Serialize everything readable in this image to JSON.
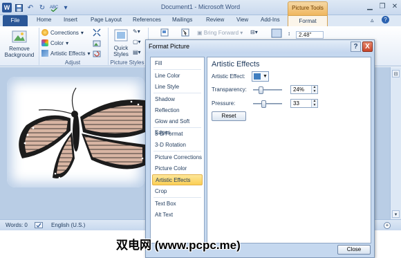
{
  "window": {
    "title": "Document1 - Microsoft Word",
    "contextual_tab_header": "Picture Tools"
  },
  "qat": {
    "app_icon": "W",
    "icons": [
      "save-icon",
      "undo-icon",
      "redo-icon",
      "spelling-icon",
      "customize-icon"
    ]
  },
  "tabs": {
    "file": "File",
    "home": "Home",
    "insert": "Insert",
    "page_layout": "Page Layout",
    "references": "References",
    "mailings": "Mailings",
    "review": "Review",
    "view": "View",
    "addins": "Add-Ins",
    "format": "Format"
  },
  "ribbon": {
    "remove_background_line1": "Remove",
    "remove_background_line2": "Background",
    "corrections": "Corrections",
    "color": "Color",
    "artistic_effects": "Artistic Effects",
    "adjust_group": "Adjust",
    "quick_styles_line1": "Quick",
    "quick_styles_line2": "Styles",
    "picture_styles_group": "Picture Styles",
    "bring_forward": "Bring Forward",
    "height_value": "2.48\""
  },
  "status": {
    "words": "Words: 0",
    "language": "English (U.S.)"
  },
  "dialog": {
    "title": "Format Picture",
    "help": "?",
    "close_x": "X",
    "nav": [
      {
        "label": "Fill"
      },
      {
        "label": "Line Color"
      },
      {
        "label": "Line Style"
      },
      {
        "label": "Shadow"
      },
      {
        "label": "Reflection"
      },
      {
        "label": "Glow and Soft Edges"
      },
      {
        "label": "3-D Format"
      },
      {
        "label": "3-D Rotation"
      },
      {
        "label": "Picture Corrections"
      },
      {
        "label": "Picture Color"
      },
      {
        "label": "Artistic Effects"
      },
      {
        "label": "Crop"
      },
      {
        "label": "Text Box"
      },
      {
        "label": "Alt Text"
      }
    ],
    "selected_nav": "Artistic Effects",
    "panel": {
      "heading": "Artistic Effects",
      "artistic_effect_label": "Artistic Effect:",
      "transparency_label": "Transparency:",
      "transparency_value": "24%",
      "transparency_level": 0.24,
      "pressure_label": "Pressure:",
      "pressure_value": "33",
      "pressure_level": 0.33,
      "reset": "Reset"
    },
    "close_button": "Close"
  },
  "watermark": "双电网 (www.pcpc.me)",
  "colors": {
    "accent": "#2b5797",
    "contextual": "#f0b75e",
    "selection": "#fbcf55"
  }
}
